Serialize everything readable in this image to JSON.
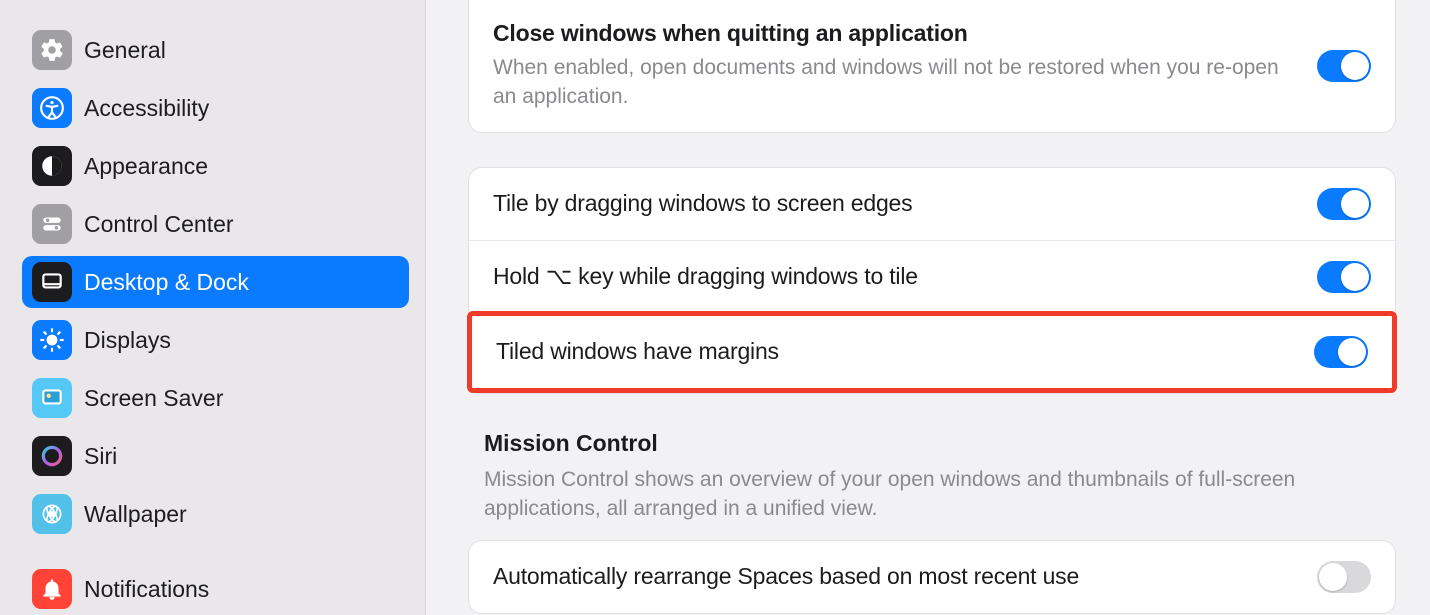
{
  "sidebar": {
    "items": [
      {
        "label": "General"
      },
      {
        "label": "Accessibility"
      },
      {
        "label": "Appearance"
      },
      {
        "label": "Control Center"
      },
      {
        "label": "Desktop & Dock"
      },
      {
        "label": "Displays"
      },
      {
        "label": "Screen Saver"
      },
      {
        "label": "Siri"
      },
      {
        "label": "Wallpaper"
      },
      {
        "label": "Notifications"
      }
    ],
    "selected_index": 4
  },
  "main": {
    "section1": {
      "row1": {
        "title": "Close windows when quitting an application",
        "desc": "When enabled, open documents and windows will not be restored when you re-open an application.",
        "toggle_on": true
      }
    },
    "section2": {
      "row1": {
        "title": "Tile by dragging windows to screen edges",
        "toggle_on": true
      },
      "row2": {
        "title": "Hold ⌥ key while dragging windows to tile",
        "toggle_on": true
      },
      "row3": {
        "title": "Tiled windows have margins",
        "toggle_on": true
      }
    },
    "mission_control": {
      "heading": "Mission Control",
      "desc": "Mission Control shows an overview of your open windows and thumbnails of full-screen applications, all arranged in a unified view."
    },
    "section3": {
      "row1": {
        "title": "Automatically rearrange Spaces based on most recent use",
        "toggle_on": false
      }
    }
  }
}
